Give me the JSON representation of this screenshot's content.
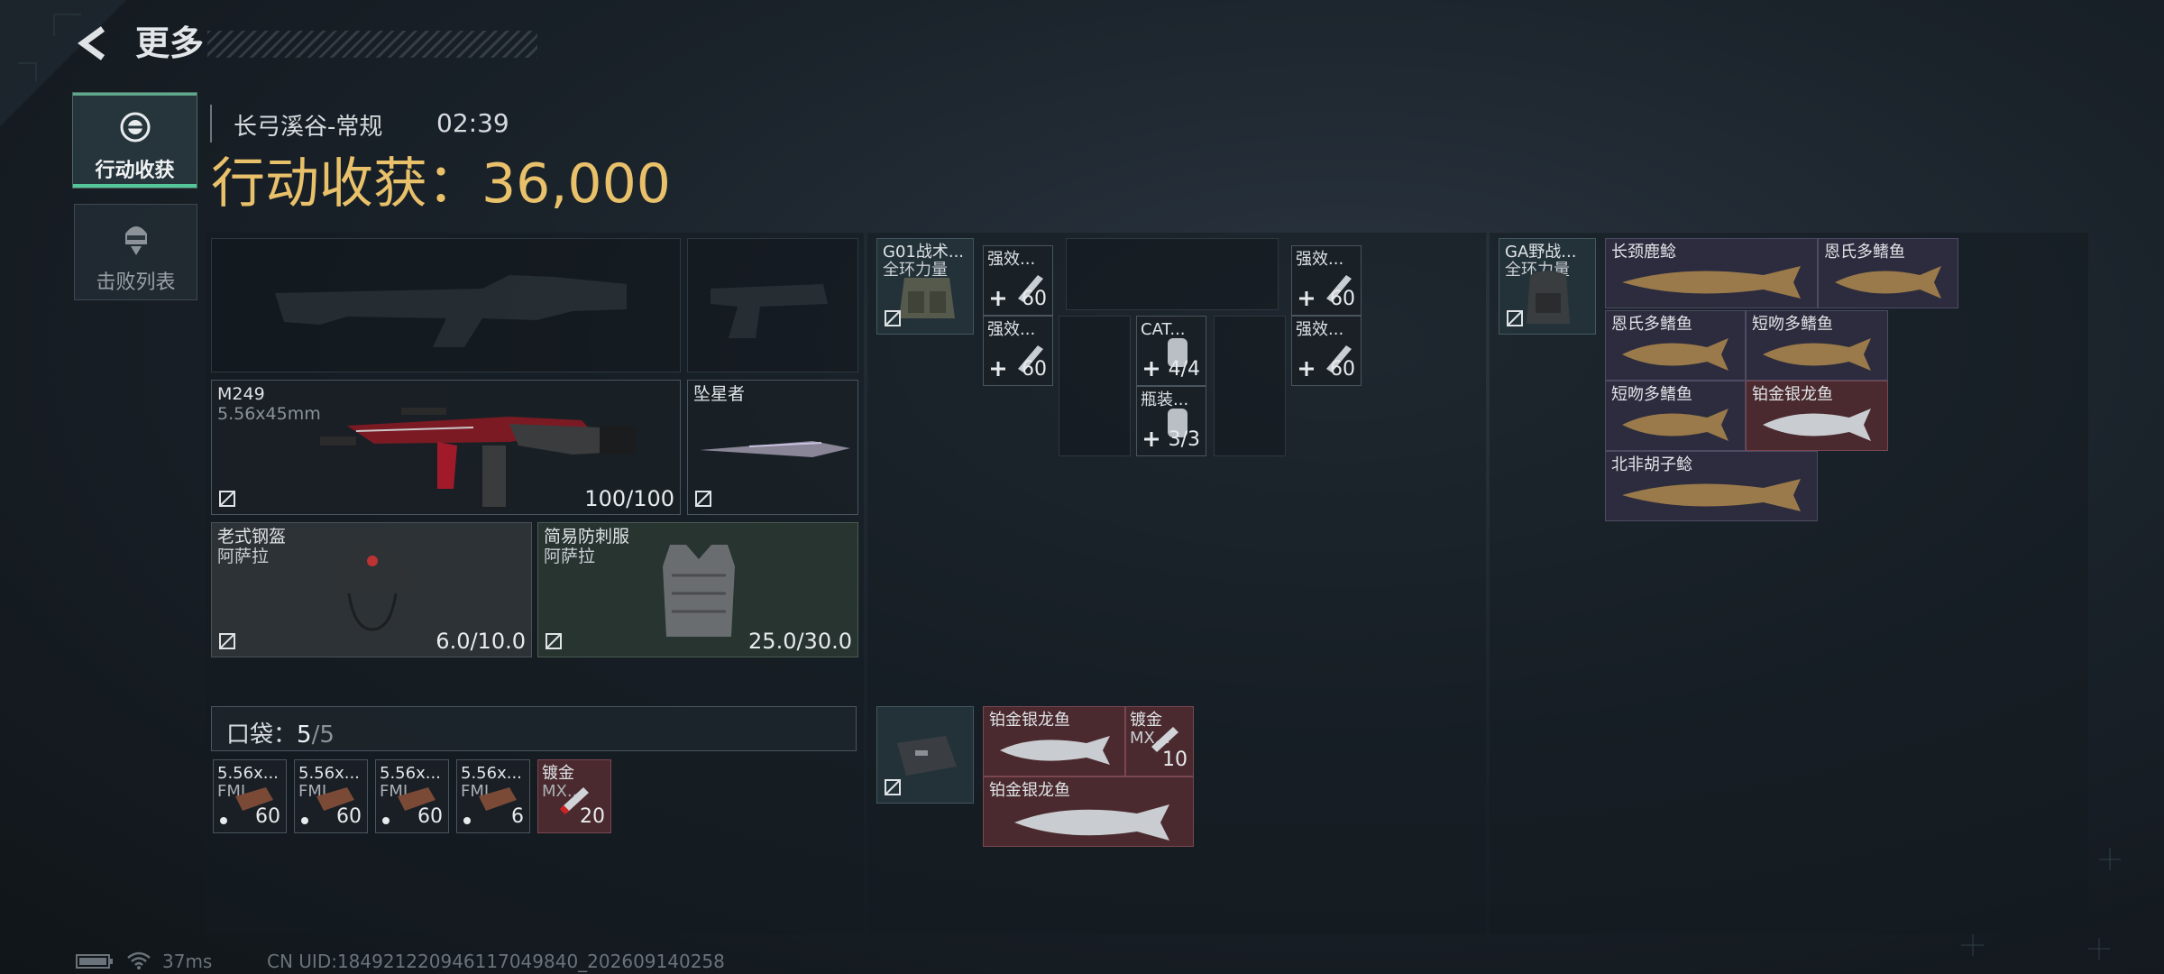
{
  "header": {
    "back_label": "更多"
  },
  "sidebar": {
    "tabs": [
      {
        "label": "行动收获",
        "active": true
      },
      {
        "label": "击败列表",
        "active": false
      }
    ]
  },
  "map_info": {
    "map_name": "长弓溪谷-常规",
    "time": "02:39"
  },
  "title": {
    "label": "行动收获：",
    "value": "36,000"
  },
  "equipment": {
    "primary": {
      "name": "M249",
      "ammo": "5.56x45mm",
      "durability": "100/100"
    },
    "secondary": {
      "name": "坠星者"
    },
    "helmet": {
      "name": "老式钢盔",
      "sub": "阿萨拉",
      "durability": "6.0/10.0"
    },
    "armor": {
      "name": "简易防刺服",
      "sub": "阿萨拉",
      "durability": "25.0/30.0"
    }
  },
  "pocket": {
    "label": "口袋：",
    "count": "5",
    "max": "/5",
    "items": [
      {
        "name": "5.56x...",
        "sub": "FMJ",
        "count": "60"
      },
      {
        "name": "5.56x...",
        "sub": "FMJ",
        "count": "60"
      },
      {
        "name": "5.56x...",
        "sub": "FMJ",
        "count": "60"
      },
      {
        "name": "5.56x...",
        "sub": "FMJ",
        "count": "6"
      },
      {
        "name": "镀金",
        "sub": "MX...",
        "count": "20"
      }
    ]
  },
  "chest_rig": {
    "name": "G01战术...",
    "sub": "全环力量",
    "items": [
      {
        "name": "强效...",
        "count": "60"
      },
      {
        "name": "强效...",
        "count": "60"
      },
      {
        "name": "CAT...",
        "count": "4/4"
      },
      {
        "name": "瓶装...",
        "count": "3/3"
      },
      {
        "name": "强效...",
        "count": "60"
      },
      {
        "name": "强效...",
        "count": "60"
      }
    ]
  },
  "case": {
    "items": [
      {
        "name": "铂金银龙鱼"
      },
      {
        "name": "镀金",
        "sub": "MX...",
        "count": "10"
      },
      {
        "name": "铂金银龙鱼"
      }
    ]
  },
  "backpack": {
    "name": "GA野战...",
    "sub": "全环力量",
    "items": [
      {
        "name": "长颈鹿鲶"
      },
      {
        "name": "恩氏多鳍鱼"
      },
      {
        "name": "恩氏多鳍鱼"
      },
      {
        "name": "短吻多鳍鱼"
      },
      {
        "name": "短吻多鳍鱼"
      },
      {
        "name": "铂金银龙鱼"
      },
      {
        "name": "北非胡子鲶"
      }
    ]
  },
  "footer": {
    "ping": "37ms",
    "uid": "CN UID:18492122094611704984​0_202609140258"
  }
}
